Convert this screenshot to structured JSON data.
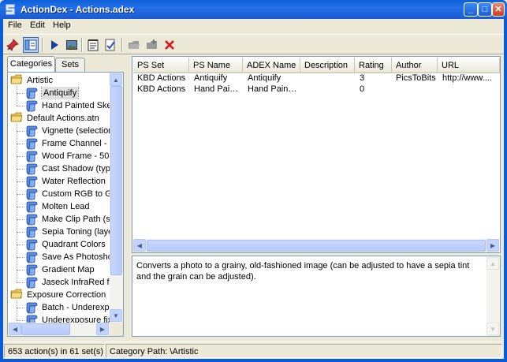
{
  "window": {
    "title": "ActionDex - Actions.adex",
    "minimize": "_",
    "maximize": "□",
    "close": "✕"
  },
  "menu": [
    "File",
    "Edit",
    "Help"
  ],
  "toolbar": {
    "buttons": [
      "pin-icon",
      "panel-view-icon",
      "play-icon",
      "image-icon",
      "notepad-icon",
      "checklist-icon",
      "folder-disabled-icon",
      "folder-add-disabled-icon",
      "delete-icon"
    ]
  },
  "tabs": {
    "categories": "Categories",
    "sets": "Sets"
  },
  "tree": [
    {
      "label": "Artistic",
      "type": "folder"
    },
    {
      "label": "Antiquify",
      "type": "action",
      "selected": true
    },
    {
      "label": "Hand Painted Ske",
      "type": "action"
    },
    {
      "label": "Default Actions.atn",
      "type": "folder"
    },
    {
      "label": "Vignette (selection",
      "type": "action"
    },
    {
      "label": "Frame Channel - 5",
      "type": "action"
    },
    {
      "label": "Wood Frame - 50",
      "type": "action"
    },
    {
      "label": "Cast Shadow (typ",
      "type": "action"
    },
    {
      "label": "Water Reflection",
      "type": "action"
    },
    {
      "label": "Custom RGB to G",
      "type": "action"
    },
    {
      "label": "Molten Lead",
      "type": "action"
    },
    {
      "label": "Make Clip Path (s",
      "type": "action"
    },
    {
      "label": "Sepia Toning (laye",
      "type": "action"
    },
    {
      "label": "Quadrant Colors",
      "type": "action"
    },
    {
      "label": "Save As Photosho",
      "type": "action"
    },
    {
      "label": "Gradient Map",
      "type": "action"
    },
    {
      "label": "Jaseck InfraRed f",
      "type": "action"
    },
    {
      "label": "Exposure Correction",
      "type": "folder"
    },
    {
      "label": "Batch - Underexp",
      "type": "action"
    },
    {
      "label": "Underexposure fix",
      "type": "action"
    }
  ],
  "columns": [
    "PS Set",
    "PS Name",
    "ADEX Name",
    "Description",
    "Rating",
    "Author",
    "URL"
  ],
  "rows": [
    [
      "KBD Actions",
      "Antiquify",
      "Antiquify",
      "",
      "3",
      "PicsToBits",
      "http://www...."
    ],
    [
      "KBD Actions",
      "Hand Pai…",
      "Hand Pain…",
      "",
      "0",
      "",
      ""
    ]
  ],
  "description": "Converts a photo to a grainy, old-fashioned image (can be adjusted to have a sepia tint and the grain can be adjusted).",
  "status": {
    "count": "653 action(s) in 61 set(s)",
    "path": "Category Path: \\Artistic"
  },
  "colors": {
    "titlebar": "#0a5fd8",
    "selection": "#316ac5",
    "frame": "#0b5bd6"
  }
}
